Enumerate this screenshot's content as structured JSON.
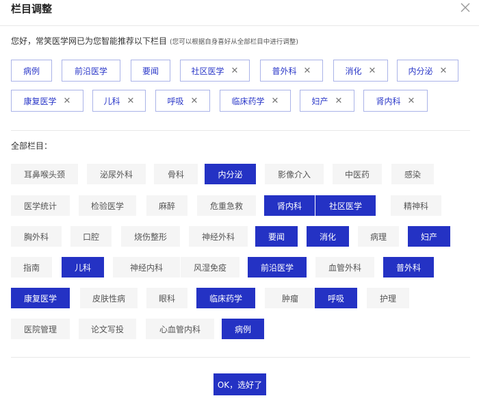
{
  "dialog": {
    "title": "栏目调整",
    "hint": "您好，常笑医学网已为您智能推荐以下栏目",
    "hint_small": "(您可以根据自身喜好从全部栏目中进行调整)",
    "all_label": "全部栏目：",
    "ok_label": "OK，选好了",
    "close_icon": "close-icon",
    "accent_color": "#2432c4",
    "tag_border_color": "#aab3e8"
  },
  "selected_tags": [
    {
      "label": "病例",
      "removable": false
    },
    {
      "label": "前沿医学",
      "removable": false
    },
    {
      "label": "要闻",
      "removable": false
    },
    {
      "label": "社区医学",
      "removable": true
    },
    {
      "label": "普外科",
      "removable": true
    },
    {
      "label": "消化",
      "removable": true
    },
    {
      "label": "内分泌",
      "removable": true
    },
    {
      "label": "康复医学",
      "removable": true
    },
    {
      "label": "儿科",
      "removable": true
    },
    {
      "label": "呼吸",
      "removable": true
    },
    {
      "label": "临床药学",
      "removable": true
    },
    {
      "label": "妇产",
      "removable": true
    },
    {
      "label": "肾内科",
      "removable": true
    }
  ],
  "all_categories": [
    [
      {
        "label": "耳鼻喉头颈",
        "selected": false
      },
      {
        "label": "泌尿外科",
        "selected": false
      },
      {
        "label": "骨科",
        "selected": false
      },
      {
        "label": "内分泌",
        "selected": true
      },
      {
        "label": "影像介入",
        "selected": false
      },
      {
        "label": "中医药",
        "selected": false
      },
      {
        "label": "感染",
        "selected": false
      }
    ],
    [
      {
        "label": "医学统计",
        "selected": false
      },
      {
        "label": "检验医学",
        "selected": false
      },
      {
        "label": "麻醉",
        "selected": false
      },
      {
        "label": "危重急救",
        "selected": false
      },
      {
        "label": "肾内科",
        "selected": true
      },
      {
        "label": "社区医学",
        "selected": true
      },
      {
        "label": "精神科",
        "selected": false
      }
    ],
    [
      {
        "label": "胸外科",
        "selected": false
      },
      {
        "label": "口腔",
        "selected": false
      },
      {
        "label": "烧伤整形",
        "selected": false
      },
      {
        "label": "神经外科",
        "selected": false
      },
      {
        "label": "要闻",
        "selected": true
      },
      {
        "label": "消化",
        "selected": true
      },
      {
        "label": "病理",
        "selected": false
      },
      {
        "label": "妇产",
        "selected": true
      }
    ],
    [
      {
        "label": "指南",
        "selected": false
      },
      {
        "label": "儿科",
        "selected": true
      },
      {
        "label": "神经内科",
        "selected": false
      },
      {
        "label": "风湿免疫",
        "selected": false
      },
      {
        "label": "前沿医学",
        "selected": true
      },
      {
        "label": "血管外科",
        "selected": false
      },
      {
        "label": "普外科",
        "selected": true
      }
    ],
    [
      {
        "label": "康复医学",
        "selected": true
      },
      {
        "label": "皮肤性病",
        "selected": false
      },
      {
        "label": "眼科",
        "selected": false
      },
      {
        "label": "临床药学",
        "selected": true
      },
      {
        "label": "肿瘤",
        "selected": false
      },
      {
        "label": "呼吸",
        "selected": true
      },
      {
        "label": "护理",
        "selected": false
      }
    ],
    [
      {
        "label": "医院管理",
        "selected": false
      },
      {
        "label": "论文写投",
        "selected": false
      },
      {
        "label": "心血管内科",
        "selected": false
      },
      {
        "label": "病例",
        "selected": true
      }
    ]
  ]
}
